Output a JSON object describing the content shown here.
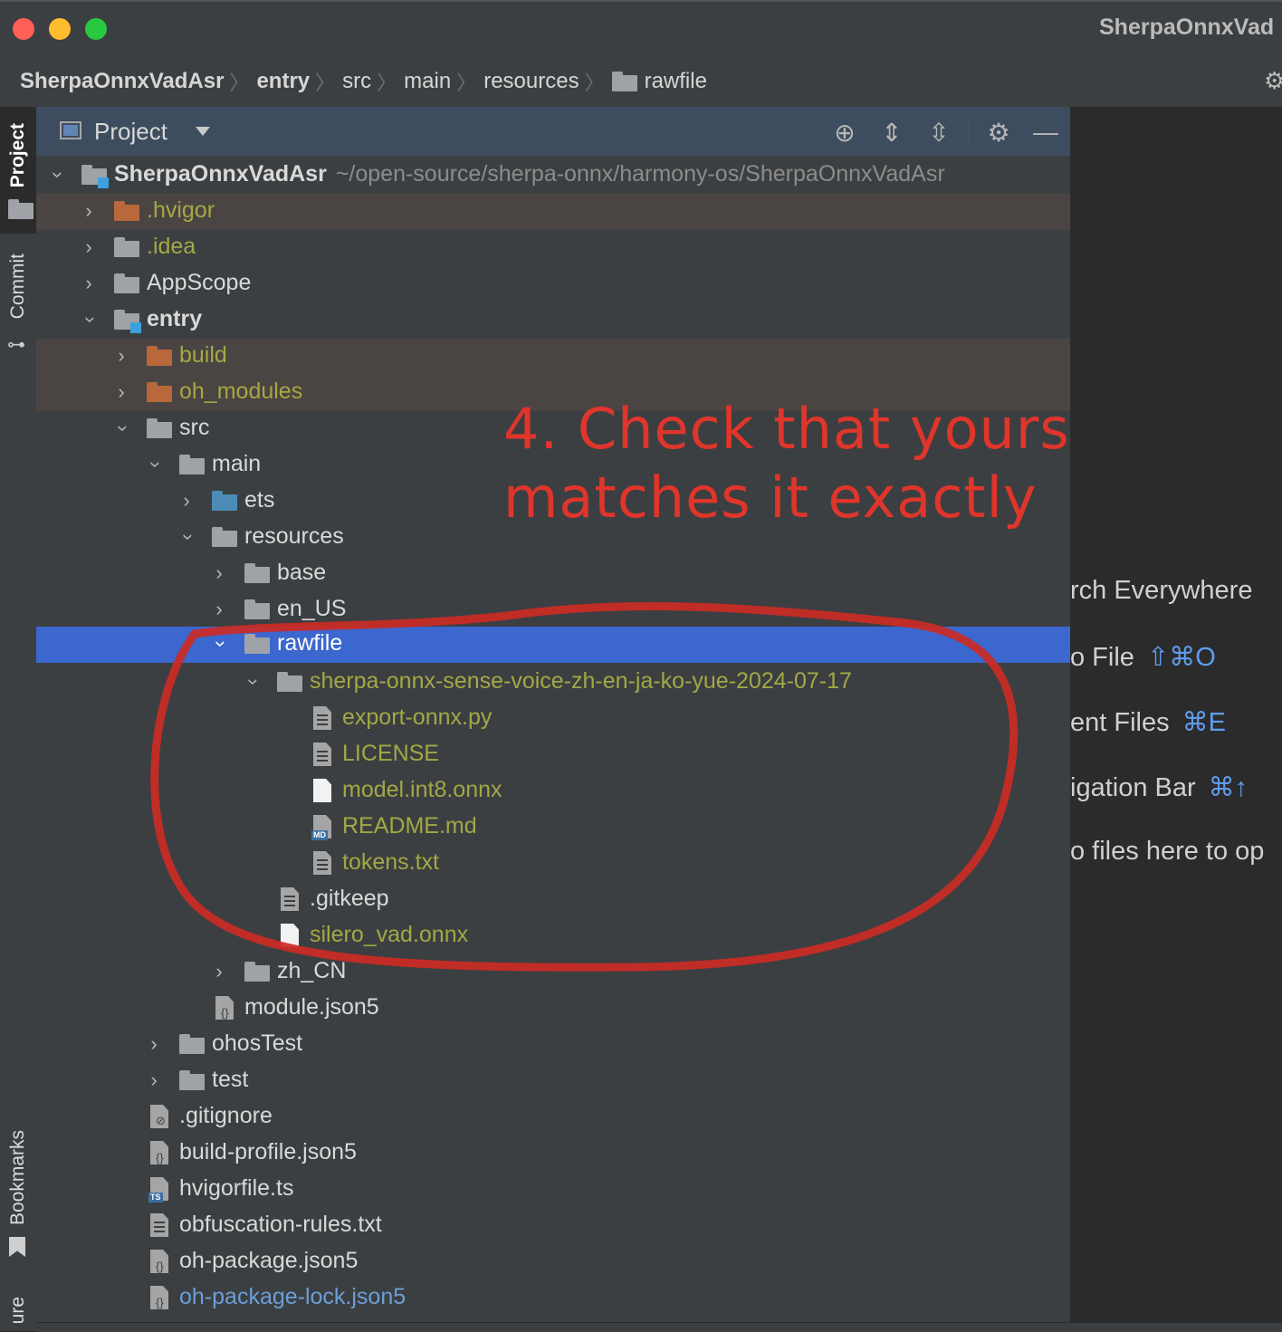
{
  "window": {
    "title": "SherpaOnnxVad"
  },
  "breadcrumb": {
    "items": [
      "SherpaOnnxVadAsr",
      "entry",
      "src",
      "main",
      "resources",
      "rawfile"
    ]
  },
  "left_stripe": {
    "project_tab": "Project",
    "commit_tab": "Commit",
    "bookmarks_tab": "Bookmarks",
    "structure_tab": "ure"
  },
  "project_panel": {
    "title": "Project",
    "icons": [
      "locate-icon",
      "expand-all-icon",
      "collapse-all-icon",
      "gear-icon",
      "hide-icon"
    ]
  },
  "tree": {
    "root_name": "SherpaOnnxVadAsr",
    "root_path": "~/open-source/sherpa-onnx/harmony-os/SherpaOnnxVadAsr",
    "rows": [
      "SherpaOnnxVadAsr",
      ".hvigor",
      ".idea",
      "AppScope",
      "entry",
      "build",
      "oh_modules",
      "src",
      "main",
      "ets",
      "resources",
      "base",
      "en_US",
      "rawfile",
      "sherpa-onnx-sense-voice-zh-en-ja-ko-yue-2024-07-17",
      "export-onnx.py",
      "LICENSE",
      "model.int8.onnx",
      "README.md",
      "tokens.txt",
      ".gitkeep",
      "silero_vad.onnx",
      "zh_CN",
      "module.json5",
      "ohosTest",
      "test",
      ".gitignore",
      "build-profile.json5",
      "hvigorfile.ts",
      "obfuscation-rules.txt",
      "oh-package.json5",
      "oh-package-lock.json5"
    ]
  },
  "editor_hints": {
    "search": "rch Everywhere",
    "goto_file": "o File",
    "goto_file_keys": "⇧⌘O",
    "recent_files": "ent Files",
    "recent_files_keys": "⌘E",
    "nav_bar": "igation Bar",
    "nav_bar_keys": "⌘↑",
    "drop_files": "o files here to op"
  },
  "annotation": {
    "line1": "4. Check that yours",
    "line2": "matches it exactly",
    "color": "#e0352b"
  },
  "colors": {
    "selected_row": "#3b67cf",
    "excluded_row": "#4a4542",
    "olive_text": "#a3a845",
    "link_text": "#6c9ed8"
  }
}
